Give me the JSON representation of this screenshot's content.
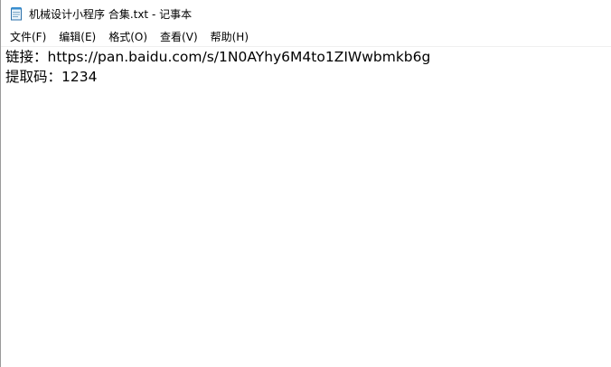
{
  "window": {
    "title": "机械设计小程序 合集.txt - 记事本",
    "icon": "notepad-icon"
  },
  "menu": {
    "items": [
      {
        "label": "文件(F)"
      },
      {
        "label": "编辑(E)"
      },
      {
        "label": "格式(O)"
      },
      {
        "label": "查看(V)"
      },
      {
        "label": "帮助(H)"
      }
    ]
  },
  "document": {
    "lines": [
      "链接：https://pan.baidu.com/s/1N0AYhy6M4to1ZIWwbmkb6g",
      "提取码：1234"
    ]
  }
}
